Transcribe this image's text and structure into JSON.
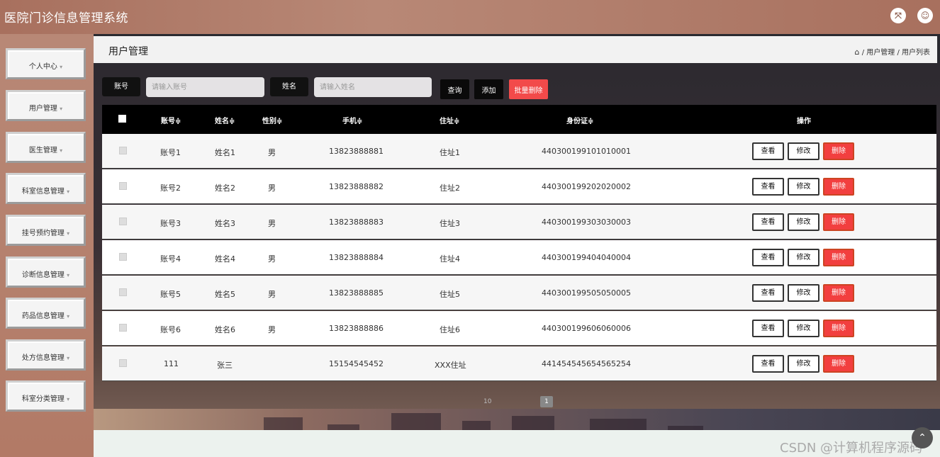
{
  "app": {
    "title": "医院门诊信息管理系统"
  },
  "topbar": {
    "fullscreen_icon": "expand-icon",
    "user_icon": "user-icon"
  },
  "sidebar": {
    "items": [
      {
        "label": "个人中心"
      },
      {
        "label": "用户管理"
      },
      {
        "label": "医生管理"
      },
      {
        "label": "科室信息管理"
      },
      {
        "label": "挂号预约管理"
      },
      {
        "label": "诊断信息管理"
      },
      {
        "label": "药品信息管理"
      },
      {
        "label": "处方信息管理"
      },
      {
        "label": "科室分类管理"
      }
    ],
    "caret": "▾"
  },
  "page": {
    "title": "用户管理",
    "breadcrumb": {
      "home_icon": "home-icon",
      "text": "/ 用户管理 / 用户列表"
    }
  },
  "search": {
    "account_label": "账号",
    "account_placeholder": "请输入账号",
    "name_label": "姓名",
    "name_placeholder": "请输入姓名",
    "query_button": "查询",
    "add_button": "添加",
    "batch_delete_button": "批量删除"
  },
  "table": {
    "columns": [
      "账号≑",
      "姓名≑",
      "性别≑",
      "手机≑",
      "住址≑",
      "身份证≑",
      "操作"
    ],
    "rows": [
      {
        "account": "账号1",
        "name": "姓名1",
        "gender": "男",
        "phone": "13823888881",
        "address": "住址1",
        "id_card": "440300199101010001"
      },
      {
        "account": "账号2",
        "name": "姓名2",
        "gender": "男",
        "phone": "13823888882",
        "address": "住址2",
        "id_card": "440300199202020002"
      },
      {
        "account": "账号3",
        "name": "姓名3",
        "gender": "男",
        "phone": "13823888883",
        "address": "住址3",
        "id_card": "440300199303030003"
      },
      {
        "account": "账号4",
        "name": "姓名4",
        "gender": "男",
        "phone": "13823888884",
        "address": "住址4",
        "id_card": "440300199404040004"
      },
      {
        "account": "账号5",
        "name": "姓名5",
        "gender": "男",
        "phone": "13823888885",
        "address": "住址5",
        "id_card": "440300199505050005"
      },
      {
        "account": "账号6",
        "name": "姓名6",
        "gender": "男",
        "phone": "13823888886",
        "address": "住址6",
        "id_card": "440300199606060006"
      },
      {
        "account": "111",
        "name": "张三",
        "gender": "",
        "phone": "15154545452",
        "address": "XXX住址",
        "id_card": "441454545654565254"
      }
    ],
    "actions": {
      "view": "查看",
      "edit": "修改",
      "delete": "删除"
    }
  },
  "pagination": {
    "page_size": "10",
    "current_page": "1"
  },
  "watermark": "CSDN @计算机程序源码"
}
